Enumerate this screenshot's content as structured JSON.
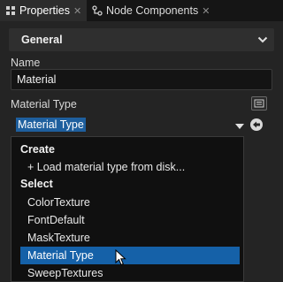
{
  "tabs": [
    {
      "label": "Properties",
      "active": true,
      "close": "✕"
    },
    {
      "label": "Node Components",
      "active": false,
      "close": "✕"
    }
  ],
  "section": {
    "title": "General"
  },
  "fields": {
    "name_label": "Name",
    "name_value": "Material",
    "material_type_label": "Material Type",
    "material_type_value": "Material Type"
  },
  "dropdown": {
    "create_header": "Create",
    "load_item": "+ Load material type from disk...",
    "select_header": "Select",
    "items": [
      "ColorTexture",
      "FontDefault",
      "MaskTexture",
      "Material Type",
      "SweepTextures"
    ],
    "selected_index": 3
  },
  "colors": {
    "accent": "#1561a8",
    "selection_text_bg": "#1e5f9e",
    "background": "#242424"
  }
}
